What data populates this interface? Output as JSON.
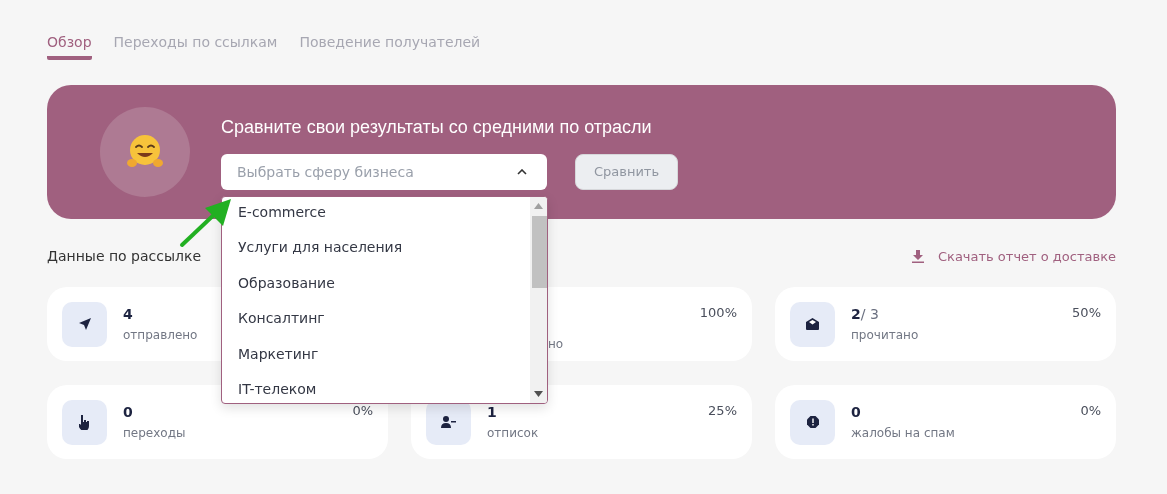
{
  "tabs": [
    {
      "label": "Обзор",
      "selected": true
    },
    {
      "label": "Переходы по ссылкам",
      "selected": false
    },
    {
      "label": "Поведение получателей",
      "selected": false
    }
  ],
  "banner": {
    "title": "Сравните свои результаты со средними по отрасли",
    "select": {
      "placeholder": "Выбрать сферу бизнеса",
      "expanded": true
    },
    "button": "Сравнить",
    "options": [
      "E-commerce",
      "Услуги для населения",
      "Образование",
      "Консалтинг",
      "Маркетинг",
      "IT-телеком"
    ]
  },
  "section_title": "Данные по рассылке",
  "download_link": "Скачать отчет о доставке",
  "cards": [
    {
      "kind": "sent",
      "value": "4",
      "label": "отправлено"
    },
    {
      "kind": "covered",
      "percent": "100%",
      "label": "но"
    },
    {
      "kind": "read",
      "value": "2",
      "total": "/ 3",
      "label": "прочитано",
      "percent": "50%"
    },
    {
      "kind": "clicks",
      "value": "0",
      "label": "переходы",
      "percent": "0%"
    },
    {
      "kind": "unsubscribes",
      "value": "1",
      "label": "отписок",
      "percent": "25%"
    },
    {
      "kind": "complaints",
      "value": "0",
      "label": "жалобы на спам",
      "percent": "0%"
    }
  ]
}
